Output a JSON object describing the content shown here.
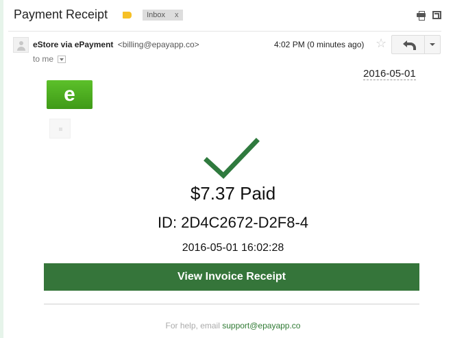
{
  "email": {
    "subject": "Payment Receipt",
    "label_chip": "Inbox",
    "label_chip_close": "x",
    "sender_name": "eStore via ePayment",
    "sender_email": "<billing@epayapp.co>",
    "recipient": "to me",
    "timestamp": "4:02 PM (0 minutes ago)"
  },
  "receipt": {
    "date": "2016-05-01",
    "logo_letter": "e",
    "amount_paid": "$7.37 Paid",
    "transaction_id": "ID: 2D4C2672-D2F8-4",
    "paid_at": "2016-05-01 16:02:28",
    "view_button_label": "View Invoice Receipt",
    "help_prefix": "For help, email",
    "help_email": "support@epayapp.co"
  },
  "colors": {
    "brand_green": "#35753a",
    "logo_green": "#4caf1f",
    "check_green": "#2f7a3e",
    "label_yellow": "#f6c026"
  },
  "icons": [
    "label-tag-icon",
    "print-icon",
    "new-window-icon",
    "avatar-icon",
    "star-icon",
    "reply-icon",
    "caret-down-icon",
    "checkmark-icon"
  ]
}
